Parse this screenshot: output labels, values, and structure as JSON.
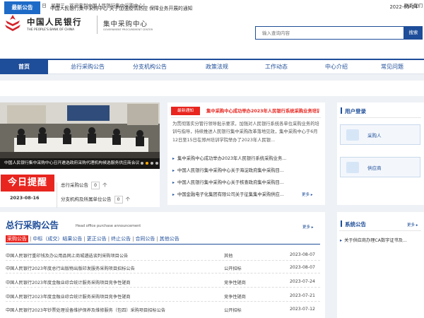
{
  "topbar": {
    "date_line": "2023 年 8 月 16 日　星期三，欢迎来到中国人民银行集中采购中心！",
    "contact": "联系我们"
  },
  "header": {
    "logo_cn": "中国人民银行",
    "logo_en": "THE PEOPLE'S BANK OF CHINA",
    "center_cn": "集中采购中心",
    "center_en": "GOVERNMENT PROCUREMENT CENTER",
    "search_placeholder": "输入查询内容",
    "search_button": "搜索",
    "brand_color": "#1e4d99",
    "accent_color": "#e8251f"
  },
  "nav": {
    "items": [
      {
        "label": "首页"
      },
      {
        "label": "总行采购公告"
      },
      {
        "label": "分支机构公告"
      },
      {
        "label": "政策法规"
      },
      {
        "label": "工作动态"
      },
      {
        "label": "中心介绍"
      },
      {
        "label": "常见问题"
      }
    ]
  },
  "ticker": {
    "label": "最新公告",
    "text": "中国人民银行集中采购中心 关于加强疫情防控 保障业务开展的通知",
    "date": "2022-03-24"
  },
  "photo": {
    "caption": "中国人民银行集中采购中心召开遴选政府采购代理机构候选服务供应商会议"
  },
  "today": {
    "badge": "今日提醒",
    "date": "2023-08-16",
    "rows": [
      {
        "label": "总行采购公告",
        "count": "0",
        "unit": "个"
      },
      {
        "label": "分支机构及所属单位公告",
        "count": "0",
        "unit": "个"
      }
    ]
  },
  "news": {
    "badge": "最新通知",
    "headline": "集中采购中心成功举办2023年人民银行系统采购业务培训班",
    "body": "为贯彻落实分管行领导批示要求，加强对人民银行系统各单位采购业务的培训与指导，持续推进人民银行集中采购改革落地见效，集中采购中心于6月12日至15日在郑州培训学院举办了2023年人民银...",
    "items": [
      "集中采购中心成功举办2023年人民银行系统采购业务...",
      "中国人民银行集中采购中心关于海淀政府集中采购目...",
      "中国人民银行集中采购中心关于核查政府集中采购目...",
      "中国金融电子化集团有限公司关于征集集中采购供应..."
    ],
    "more": "更多"
  },
  "login": {
    "title": "用户登录",
    "buttons": [
      "采购人",
      "供应商"
    ]
  },
  "announcements": {
    "title": "总行采购公告",
    "subtitle": "Head office purchase announcement",
    "more": "更多",
    "tabs": [
      "采购公告",
      "中标（成交）结果公告",
      "更正公告",
      "终止公告",
      "合同公告",
      "其他公告"
    ],
    "rows": [
      {
        "title": "中国人民银行重印钱及办公用品网上商城遴选谈判采购项目公告",
        "type": "其他",
        "date": "2023-08-07"
      },
      {
        "title": "中国人民银行2023年度总行出版物出版印发服务采购项目招标公告",
        "type": "公开招标",
        "date": "2023-08-07"
      },
      {
        "title": "中国人民银行2023年度金融业综合统计服务采购项目竞争性磋商",
        "type": "竞争性磋商",
        "date": "2023-07-24"
      },
      {
        "title": "中国人民银行2023年度金融业综合统计服务采购项目竞争性磋商",
        "type": "竞争性磋商",
        "date": "2023-07-21"
      },
      {
        "title": "中国人民银行2023年钞票处理设备维护保养及维修服务（包四）采购项目招标公告",
        "type": "公开招标",
        "date": "2023-07-12"
      }
    ]
  },
  "system": {
    "title": "系统公告",
    "more": "更多",
    "items": [
      "关于供应商办理CA数字证书及..."
    ]
  }
}
